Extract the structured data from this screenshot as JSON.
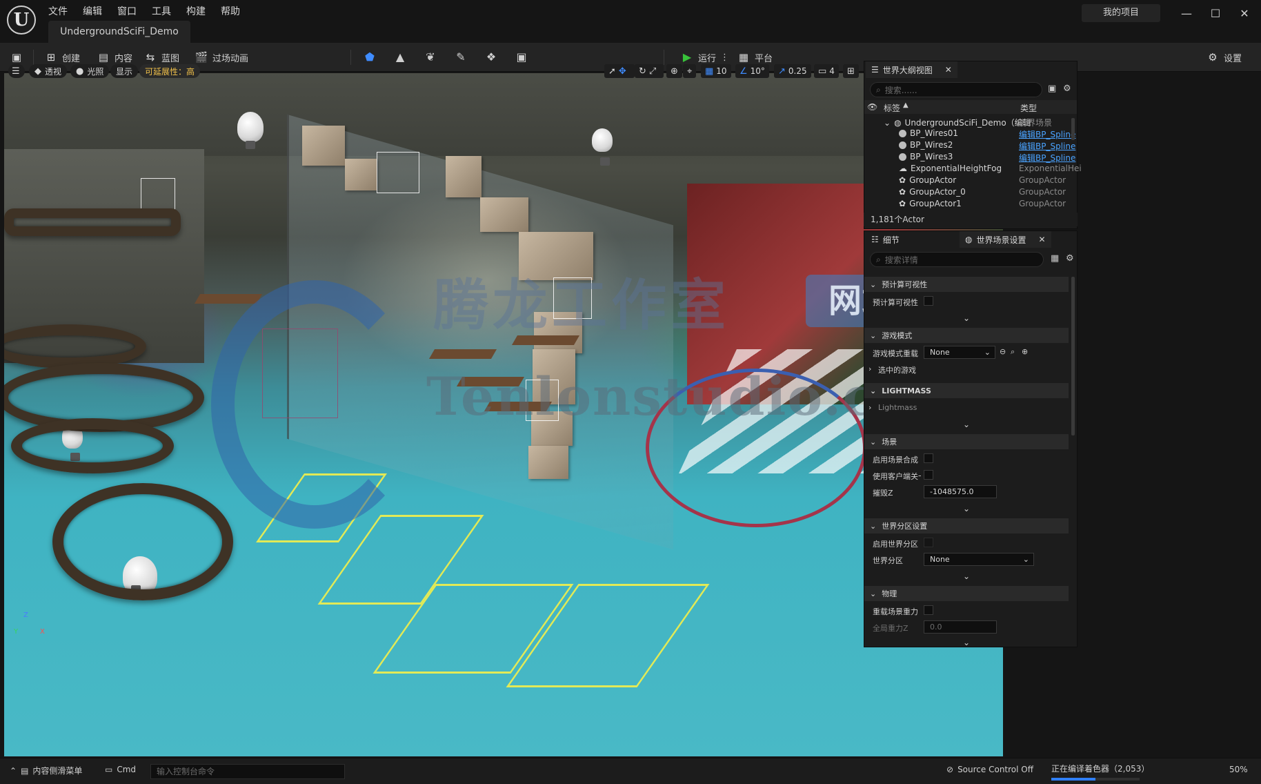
{
  "titlebar": {
    "logo_text": "U",
    "menu": [
      "文件",
      "编辑",
      "窗口",
      "工具",
      "构建",
      "帮助"
    ],
    "project_tab": "UndergroundSciFi_Demo",
    "project_name": "我的项目",
    "window_buttons": [
      "—",
      "☐",
      "✕"
    ]
  },
  "toolbar": {
    "save_icon": "💾",
    "create_label": "创建",
    "content_label": "内容",
    "blueprint_label": "蓝图",
    "cinematics_label": "过场动画",
    "run_label": "运行",
    "platform_label": "平台",
    "settings_label": "设置",
    "mode_icons": [
      "select-mode-icon",
      "landscape-mode-icon",
      "foliage-mode-icon",
      "mesh-paint-mode-icon",
      "fracture-mode-icon",
      "modeling-mode-icon"
    ]
  },
  "viewport": {
    "view_mode": "透视",
    "lighting": "光照",
    "show": "显示",
    "scalability": "可延展性：高",
    "grid_snap": "10",
    "rotation_snap": "10°",
    "scale_snap": "0.25",
    "camera_speed": "4",
    "axis": {
      "z": "Z",
      "x": "X",
      "y": "Y"
    }
  },
  "watermark": {
    "cn": "腾龙工作室",
    "box": "网站",
    "en": "Tenlonstudio.com"
  },
  "outliner": {
    "tab_label": "世界大纲视图",
    "search_placeholder": "搜索......",
    "col_label": "标签",
    "col_type": "类型",
    "rows": [
      {
        "name": "UndergroundSciFi_Demo（编辑",
        "type": "世界场景",
        "link": false
      },
      {
        "name": "BP_Wires01",
        "type": "编辑BP_Spline",
        "link": true
      },
      {
        "name": "BP_Wires2",
        "type": "编辑BP_Spline",
        "link": true
      },
      {
        "name": "BP_Wires3",
        "type": "编辑BP_Spline",
        "link": true
      },
      {
        "name": "ExponentialHeightFog",
        "type": "ExponentialHei",
        "link": false
      },
      {
        "name": "GroupActor",
        "type": "GroupActor",
        "link": false
      },
      {
        "name": "GroupActor_0",
        "type": "GroupActor",
        "link": false
      },
      {
        "name": "GroupActor1",
        "type": "GroupActor",
        "link": false
      }
    ],
    "actor_count": "1,181个Actor"
  },
  "details": {
    "tab_details": "细节",
    "tab_world_settings": "世界场景设置",
    "search_placeholder": "搜索详情",
    "sections": {
      "precomputed_visibility": "预计算可视性",
      "precomputed_visibility_row": "预计算可视性",
      "game_mode": "游戏模式",
      "game_mode_override": "游戏模式重载",
      "game_mode_value": "None",
      "selected_game": "选中的游戏",
      "lightmass": "LIGHTMASS",
      "lightmass_row": "Lightmass",
      "world": "场景",
      "enable_world_composition": "启用场景合成",
      "use_client_side": "使用客户端关卡",
      "kill_z": "摧毁Z",
      "kill_z_value": "-1048575.0",
      "world_partition_settings": "世界分区设置",
      "enable_world_partition": "启用世界分区",
      "world_partition": "世界分区",
      "world_partition_value": "None",
      "physics": "物理",
      "override_gravity": "重载场景重力",
      "global_gravity_z": "全局重力Z",
      "global_gravity_value": "0.0"
    }
  },
  "statusbar": {
    "content_drawer": "内容侧滑菜单",
    "cmd": "Cmd",
    "console_placeholder": "输入控制台命令",
    "source_control": "Source Control Off",
    "compiling": "正在编译着色器（2,053）",
    "progress_label": "50%",
    "progress": 0.5
  }
}
